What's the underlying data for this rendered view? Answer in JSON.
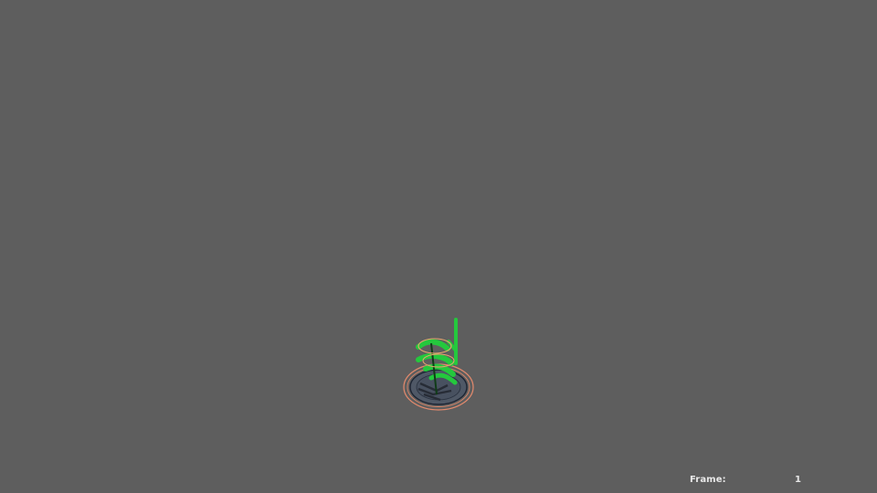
{
  "viewport": {
    "background_color": "#5e5e5e",
    "hud": {
      "frame_label": "Frame:",
      "frame_value": "1"
    },
    "scene": {
      "object": "character-rig",
      "controls_color": "#22c83a",
      "root_ring_color": "#e8886a"
    }
  }
}
